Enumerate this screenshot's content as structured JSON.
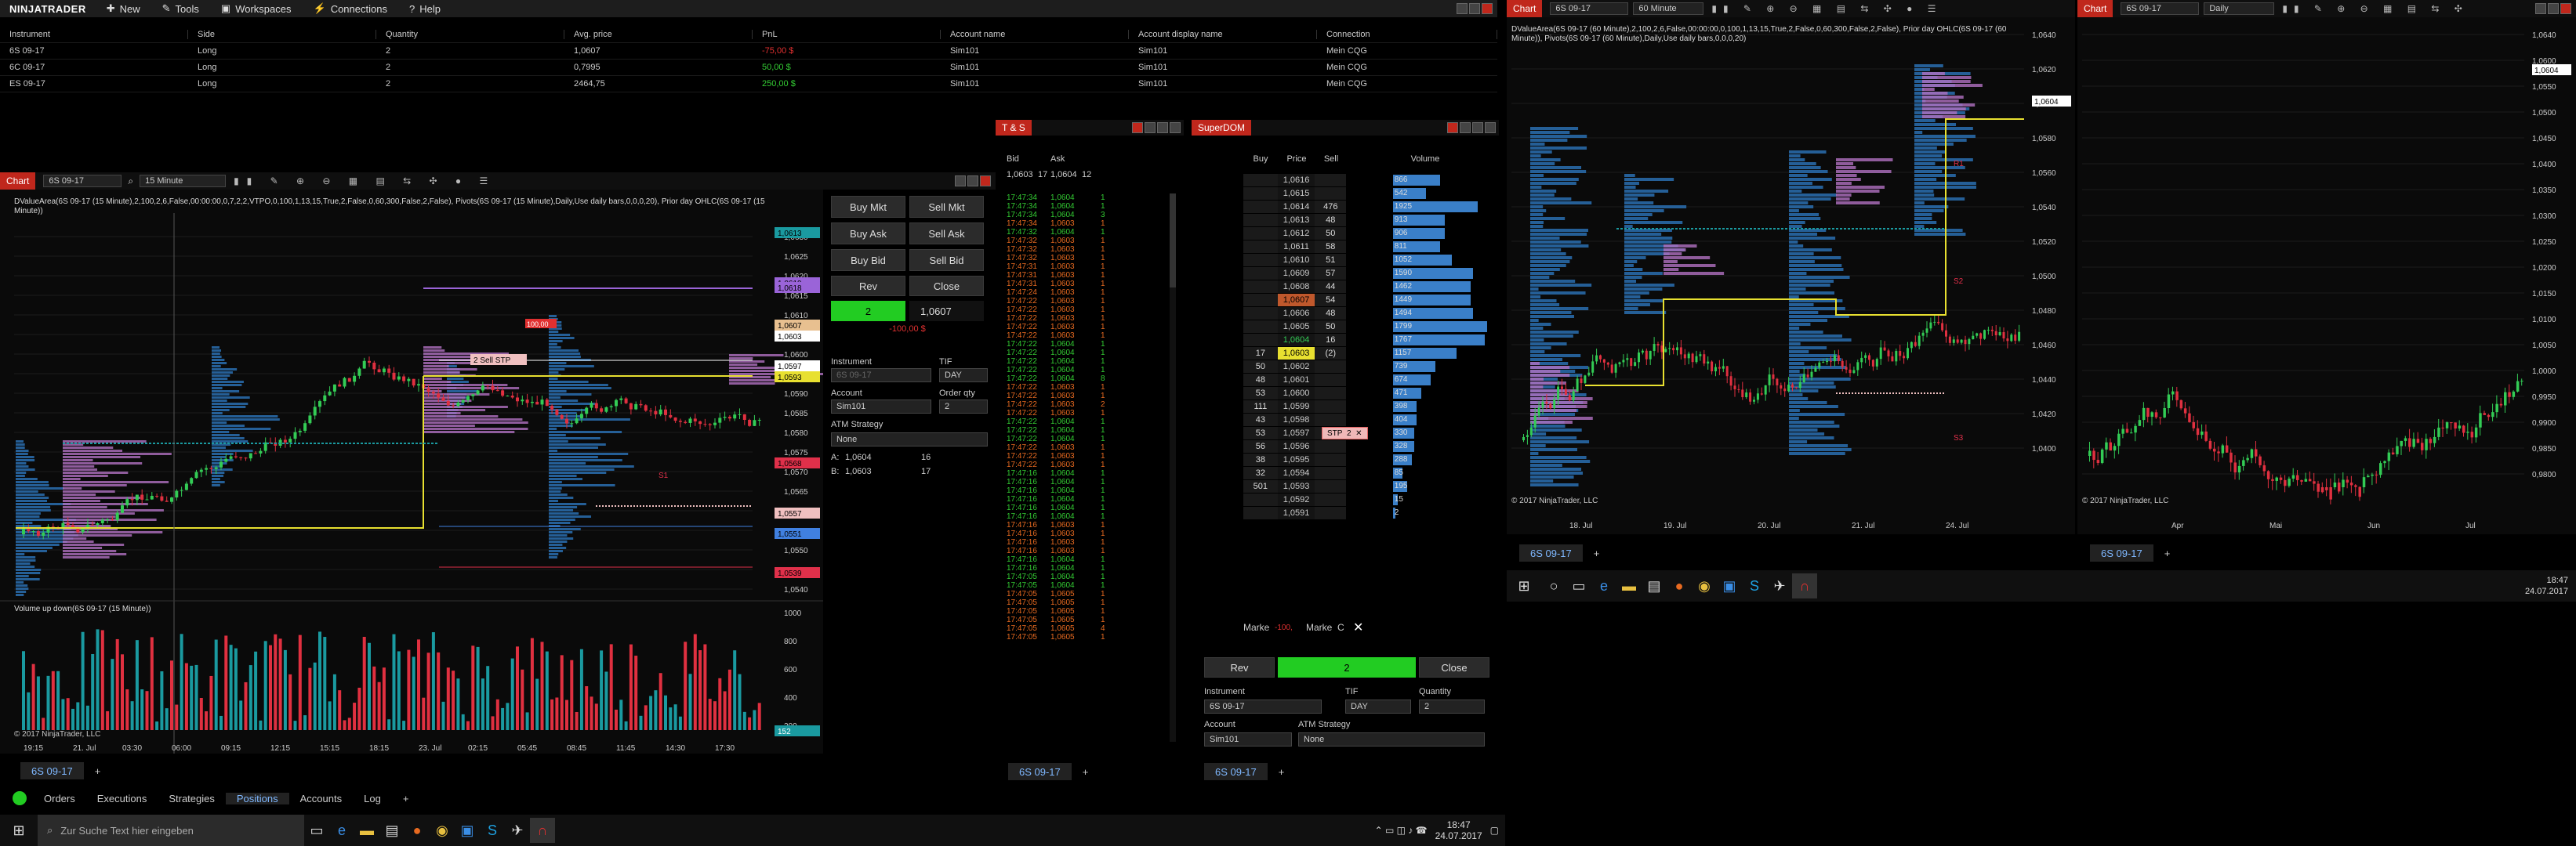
{
  "menu": {
    "logo": "NINJATRADER",
    "items": [
      {
        "label": "New",
        "icon": "plus-icon"
      },
      {
        "label": "Tools",
        "icon": "wrench-icon"
      },
      {
        "label": "Workspaces",
        "icon": "folder-icon"
      },
      {
        "label": "Connections",
        "icon": "plug-icon"
      },
      {
        "label": "Help",
        "icon": "help-icon"
      }
    ]
  },
  "positions": {
    "headers": [
      "Instrument",
      "Side",
      "Quantity",
      "Avg. price",
      "PnL",
      "Account name",
      "Account display name",
      "Connection"
    ],
    "rows": [
      {
        "instrument": "6S 09-17",
        "side": "Long",
        "qty": "2",
        "avg": "1,0607",
        "pnl": "-75,00 $",
        "account": "Sim101",
        "display": "Sim101",
        "conn": "Mein CQG",
        "pnl_color": "#e03030"
      },
      {
        "instrument": "6C 09-17",
        "side": "Long",
        "qty": "2",
        "avg": "0,7995",
        "pnl": "50,00 $",
        "account": "Sim101",
        "display": "Sim101",
        "conn": "Mein CQG",
        "pnl_color": "#33cc33"
      },
      {
        "instrument": "ES 09-17",
        "side": "Long",
        "qty": "2",
        "avg": "2464,75",
        "pnl": "250,00 $",
        "account": "Sim101",
        "display": "Sim101",
        "conn": "Mein CQG",
        "pnl_color": "#33cc33"
      }
    ]
  },
  "chart1": {
    "title": "Chart",
    "instrument": "6S 09-17",
    "interval": "15 Minute",
    "indicator_text": "DValueArea(6S 09-17 (15 Minute),2,100,2,6,False,00:00:00,0,7,2,2,VTPO,0,100,1,13,15,True,2,False,0,60,300,False,2,False), Pivots(6S 09-17 (15 Minute),Daily,Use daily bars,0,0,0,20), Prior day OHLC(6S 09-17 (15 Minute))",
    "volume_label": "Volume up down(6S 09-17 (15 Minute))",
    "copyright": "© 2017 NinjaTrader, LLC",
    "price_labels": [
      "1,0630",
      "1,0625",
      "1,0620",
      "1,0615",
      "1,0610",
      "1,0605",
      "1,0600",
      "1,0595",
      "1,0590",
      "1,0585",
      "1,0580",
      "1,0575",
      "1,0570",
      "1,0565",
      "1,0560",
      "1,0555",
      "1,0550",
      "1,0545",
      "1,0540"
    ],
    "tags": [
      {
        "text": "1,0613",
        "color": "#1a9aa0"
      },
      {
        "text": "1,0619",
        "color": "#9a64d8"
      },
      {
        "text": "1,0618",
        "color": "#9a64d8"
      },
      {
        "text": "1,0607",
        "color": "#e8c090"
      },
      {
        "text": "1,0603",
        "color": "#ffffff"
      },
      {
        "text": "1,0597",
        "color": "#ffffff"
      },
      {
        "text": "1,0593",
        "color": "#e8e030"
      },
      {
        "text": "1,0568",
        "color": "#e0304a"
      },
      {
        "text": "1,0557",
        "color": "#f0c0c0"
      },
      {
        "text": "1,0551",
        "color": "#4080e0"
      },
      {
        "text": "1,0539",
        "color": "#e0304a"
      }
    ],
    "volume_axis": [
      "1000",
      "800",
      "600",
      "400",
      "200"
    ],
    "volume_tag": "152",
    "time_labels": [
      "19:15",
      "21. Jul",
      "03:30",
      "06:00",
      "09:15",
      "12:15",
      "15:15",
      "18:15",
      "23. Jul",
      "02:15",
      "05:45",
      "08:45",
      "11:45",
      "14:30",
      "17:30"
    ],
    "s1_label": "S1",
    "order_tag": "2  Sell STP",
    "pnl_marker": "100,00",
    "tab": "6S 09-17"
  },
  "chart_trader": {
    "buy_mkt": "Buy Mkt",
    "sell_mkt": "Sell Mkt",
    "buy_ask": "Buy Ask",
    "sell_ask": "Sell Ask",
    "buy_bid": "Buy Bid",
    "sell_bid": "Sell Bid",
    "rev": "Rev",
    "close": "Close",
    "position_qty": "2",
    "position_price": "1,0607",
    "position_pnl": "-100,00 $",
    "instrument_label": "Instrument",
    "instrument_value": "6S 09-17",
    "tif_label": "TIF",
    "tif_value": "DAY",
    "account_label": "Account",
    "account_value": "Sim101",
    "qty_label": "Order qty",
    "qty_value": "2",
    "atm_label": "ATM Strategy",
    "atm_value": "None",
    "ask_label": "A:",
    "ask_price": "1,0604",
    "ask_size": "16",
    "bid_label": "B:",
    "bid_price": "1,0603",
    "bid_size": "17"
  },
  "ts": {
    "title": "T & S",
    "bid_label": "Bid",
    "ask_label": "Ask",
    "bid_price": "1,0603",
    "bid_size": "17",
    "ask_price": "1,0604",
    "ask_size": "12",
    "tab": "6S 09-17",
    "rows": [
      [
        "17:47:34",
        "1,0604",
        "1",
        "g"
      ],
      [
        "17:47:34",
        "1,0604",
        "1",
        "g"
      ],
      [
        "17:47:34",
        "1,0604",
        "3",
        "g"
      ],
      [
        "17:47:34",
        "1,0603",
        "1",
        "r"
      ],
      [
        "17:47:32",
        "1,0604",
        "1",
        "g"
      ],
      [
        "17:47:32",
        "1,0603",
        "1",
        "r"
      ],
      [
        "17:47:32",
        "1,0603",
        "1",
        "r"
      ],
      [
        "17:47:32",
        "1,0603",
        "1",
        "r"
      ],
      [
        "17:47:31",
        "1,0603",
        "1",
        "r"
      ],
      [
        "17:47:31",
        "1,0603",
        "1",
        "r"
      ],
      [
        "17:47:31",
        "1,0603",
        "1",
        "r"
      ],
      [
        "17:47:24",
        "1,0603",
        "1",
        "r"
      ],
      [
        "17:47:22",
        "1,0603",
        "1",
        "r"
      ],
      [
        "17:47:22",
        "1,0603",
        "1",
        "r"
      ],
      [
        "17:47:22",
        "1,0603",
        "1",
        "r"
      ],
      [
        "17:47:22",
        "1,0603",
        "1",
        "r"
      ],
      [
        "17:47:22",
        "1,0603",
        "1",
        "r"
      ],
      [
        "17:47:22",
        "1,0604",
        "1",
        "g"
      ],
      [
        "17:47:22",
        "1,0604",
        "1",
        "g"
      ],
      [
        "17:47:22",
        "1,0604",
        "1",
        "g"
      ],
      [
        "17:47:22",
        "1,0604",
        "1",
        "g"
      ],
      [
        "17:47:22",
        "1,0604",
        "8",
        "g"
      ],
      [
        "17:47:22",
        "1,0603",
        "1",
        "r"
      ],
      [
        "17:47:22",
        "1,0603",
        "1",
        "r"
      ],
      [
        "17:47:22",
        "1,0603",
        "2",
        "r"
      ],
      [
        "17:47:22",
        "1,0603",
        "1",
        "r"
      ],
      [
        "17:47:22",
        "1,0604",
        "1",
        "g"
      ],
      [
        "17:47:22",
        "1,0604",
        "1",
        "g"
      ],
      [
        "17:47:22",
        "1,0604",
        "1",
        "g"
      ],
      [
        "17:47:22",
        "1,0603",
        "1",
        "r"
      ],
      [
        "17:47:22",
        "1,0603",
        "1",
        "r"
      ],
      [
        "17:47:22",
        "1,0603",
        "1",
        "r"
      ],
      [
        "17:47:16",
        "1,0604",
        "1",
        "g"
      ],
      [
        "17:47:16",
        "1,0604",
        "1",
        "g"
      ],
      [
        "17:47:16",
        "1,0604",
        "1",
        "g"
      ],
      [
        "17:47:16",
        "1,0604",
        "1",
        "g"
      ],
      [
        "17:47:16",
        "1,0604",
        "1",
        "g"
      ],
      [
        "17:47:16",
        "1,0604",
        "1",
        "g"
      ],
      [
        "17:47:16",
        "1,0603",
        "1",
        "r"
      ],
      [
        "17:47:16",
        "1,0603",
        "1",
        "r"
      ],
      [
        "17:47:16",
        "1,0603",
        "1",
        "r"
      ],
      [
        "17:47:16",
        "1,0603",
        "1",
        "r"
      ],
      [
        "17:47:16",
        "1,0604",
        "1",
        "g"
      ],
      [
        "17:47:16",
        "1,0604",
        "1",
        "g"
      ],
      [
        "17:47:05",
        "1,0604",
        "1",
        "g"
      ],
      [
        "17:47:05",
        "1,0604",
        "1",
        "g"
      ],
      [
        "17:47:05",
        "1,0605",
        "1",
        "r"
      ],
      [
        "17:47:05",
        "1,0605",
        "1",
        "r"
      ],
      [
        "17:47:05",
        "1,0605",
        "1",
        "r"
      ],
      [
        "17:47:05",
        "1,0605",
        "1",
        "r"
      ],
      [
        "17:47:05",
        "1,0605",
        "4",
        "r"
      ],
      [
        "17:47:05",
        "1,0605",
        "1",
        "r"
      ]
    ]
  },
  "superdom": {
    "title": "SuperDOM",
    "col_buy": "Buy",
    "col_price": "Price",
    "col_sell": "Sell",
    "col_volume": "Volume",
    "rows": [
      {
        "buy": "",
        "price": "1,0616",
        "sell": "",
        "vol": "866",
        "w": 20
      },
      {
        "buy": "",
        "price": "1,0615",
        "sell": "",
        "vol": "542",
        "w": 14
      },
      {
        "buy": "",
        "price": "1,0614",
        "sell": "476",
        "vol": "1925",
        "w": 36
      },
      {
        "buy": "",
        "price": "1,0613",
        "sell": "48",
        "vol": "913",
        "w": 22
      },
      {
        "buy": "",
        "price": "1,0612",
        "sell": "50",
        "vol": "906",
        "w": 22
      },
      {
        "buy": "",
        "price": "1,0611",
        "sell": "58",
        "vol": "811",
        "w": 20
      },
      {
        "buy": "",
        "price": "1,0610",
        "sell": "51",
        "vol": "1052",
        "w": 25
      },
      {
        "buy": "",
        "price": "1,0609",
        "sell": "57",
        "vol": "1590",
        "w": 34
      },
      {
        "buy": "",
        "price": "1,0608",
        "sell": "44",
        "vol": "1462",
        "w": 33
      },
      {
        "buy": "",
        "price": "1,0607",
        "sell": "54",
        "vol": "1449",
        "w": 33,
        "hl": "entry"
      },
      {
        "buy": "",
        "price": "1,0606",
        "sell": "48",
        "vol": "1494",
        "w": 34
      },
      {
        "buy": "",
        "price": "1,0605",
        "sell": "50",
        "vol": "1799",
        "w": 40
      },
      {
        "buy": "",
        "price": "1,0604",
        "sell": "16",
        "vol": "1767",
        "w": 39,
        "hl": "ask"
      },
      {
        "buy": "17",
        "price": "1,0603",
        "sell": "(2)",
        "vol": "1157",
        "w": 27,
        "hl": "last"
      },
      {
        "buy": "50",
        "price": "1,0602",
        "sell": "",
        "vol": "739",
        "w": 18
      },
      {
        "buy": "48",
        "price": "1,0601",
        "sell": "",
        "vol": "674",
        "w": 16
      },
      {
        "buy": "53",
        "price": "1,0600",
        "sell": "",
        "vol": "471",
        "w": 12
      },
      {
        "buy": "111",
        "price": "1,0599",
        "sell": "",
        "vol": "398",
        "w": 10
      },
      {
        "buy": "43",
        "price": "1,0598",
        "sell": "",
        "vol": "404",
        "w": 10
      },
      {
        "buy": "53",
        "price": "1,0597",
        "sell": "",
        "vol": "330",
        "w": 9,
        "stp": true
      },
      {
        "buy": "56",
        "price": "1,0596",
        "sell": "",
        "vol": "328",
        "w": 9
      },
      {
        "buy": "38",
        "price": "1,0595",
        "sell": "",
        "vol": "288",
        "w": 8
      },
      {
        "buy": "32",
        "price": "1,0594",
        "sell": "",
        "vol": "85",
        "w": 4
      },
      {
        "buy": "501",
        "price": "1,0593",
        "sell": "",
        "vol": "195",
        "w": 6
      },
      {
        "buy": "",
        "price": "1,0592",
        "sell": "",
        "vol": "15",
        "w": 2
      },
      {
        "buy": "",
        "price": "1,0591",
        "sell": "",
        "vol": "2",
        "w": 1
      }
    ],
    "stp_label": "STP",
    "stp_qty": "2",
    "market_left": "Marke",
    "market_pnl": "-100,",
    "market_right": "Marke",
    "market_c": "C",
    "rev": "Rev",
    "close": "Close",
    "pos_qty": "2",
    "instrument_label": "Instrument",
    "instrument_value": "6S 09-17",
    "tif_label": "TIF",
    "tif_value": "DAY",
    "qty_label": "Quantity",
    "qty_value": "2",
    "account_label": "Account",
    "account_value": "Sim101",
    "atm_label": "ATM Strategy",
    "atm_value": "None",
    "tab": "6S 09-17"
  },
  "chart2": {
    "title": "Chart",
    "instrument": "6S 09-17",
    "interval": "60 Minute",
    "indicator_text": "DValueArea(6S 09-17 (60 Minute),2,100,2,6,False,00:00:00,0,100,1,13,15,True,2,False,0,60,300,False,2,False), Prior day OHLC(6S 09-17 (60 Minute)), Pivots(6S 09-17 (60 Minute),Daily,Use daily bars,0,0,0,20)",
    "price_labels": [
      "1,0640",
      "1,0620",
      "1,0600",
      "1,0580",
      "1,0560",
      "1,0540",
      "1,0520",
      "1,0500",
      "1,0480",
      "1,0460",
      "1,0440",
      "1,0420",
      "1,0400"
    ],
    "current_tag": "1,0604",
    "time_labels": [
      "18. Jul",
      "19. Jul",
      "20. Jul",
      "21. Jul",
      "24. Jul"
    ],
    "copyright": "© 2017 NinjaTrader, LLC",
    "tab": "6S 09-17",
    "r1": "R1",
    "s2": "S2",
    "s3": "S3"
  },
  "chart3": {
    "title": "Chart",
    "instrument": "6S 09-17",
    "interval": "Daily",
    "price_labels": [
      "1,0640",
      "1,0600",
      "1,0550",
      "1,0500",
      "1,0450",
      "1,0400",
      "1,0350",
      "1,0300",
      "1,0250",
      "1,0200",
      "1,0150",
      "1,0100",
      "1,0050",
      "1,0000",
      "0,9950",
      "0,9900",
      "0,9850",
      "0,9800"
    ],
    "current_tag": "1,0604",
    "time_labels": [
      "Apr",
      "Mai",
      "Jun",
      "Jul"
    ],
    "copyright": "© 2017 NinjaTrader, LLC",
    "tab": "6S 09-17"
  },
  "bottom_tabs": [
    "Orders",
    "Executions",
    "Strategies",
    "Positions",
    "Accounts",
    "Log"
  ],
  "taskbar_left": {
    "search_placeholder": "Zur Suche Text hier eingeben",
    "time": "18:47",
    "date": "24.07.2017"
  },
  "taskbar_right": {
    "time": "18:47",
    "date": "24.07.2017"
  },
  "colors": {
    "accent_red": "#c0271c",
    "up": "#33cc55",
    "down": "#e03040",
    "blue_profile": "#2a6fb0",
    "purple_profile": "#b070c0"
  }
}
